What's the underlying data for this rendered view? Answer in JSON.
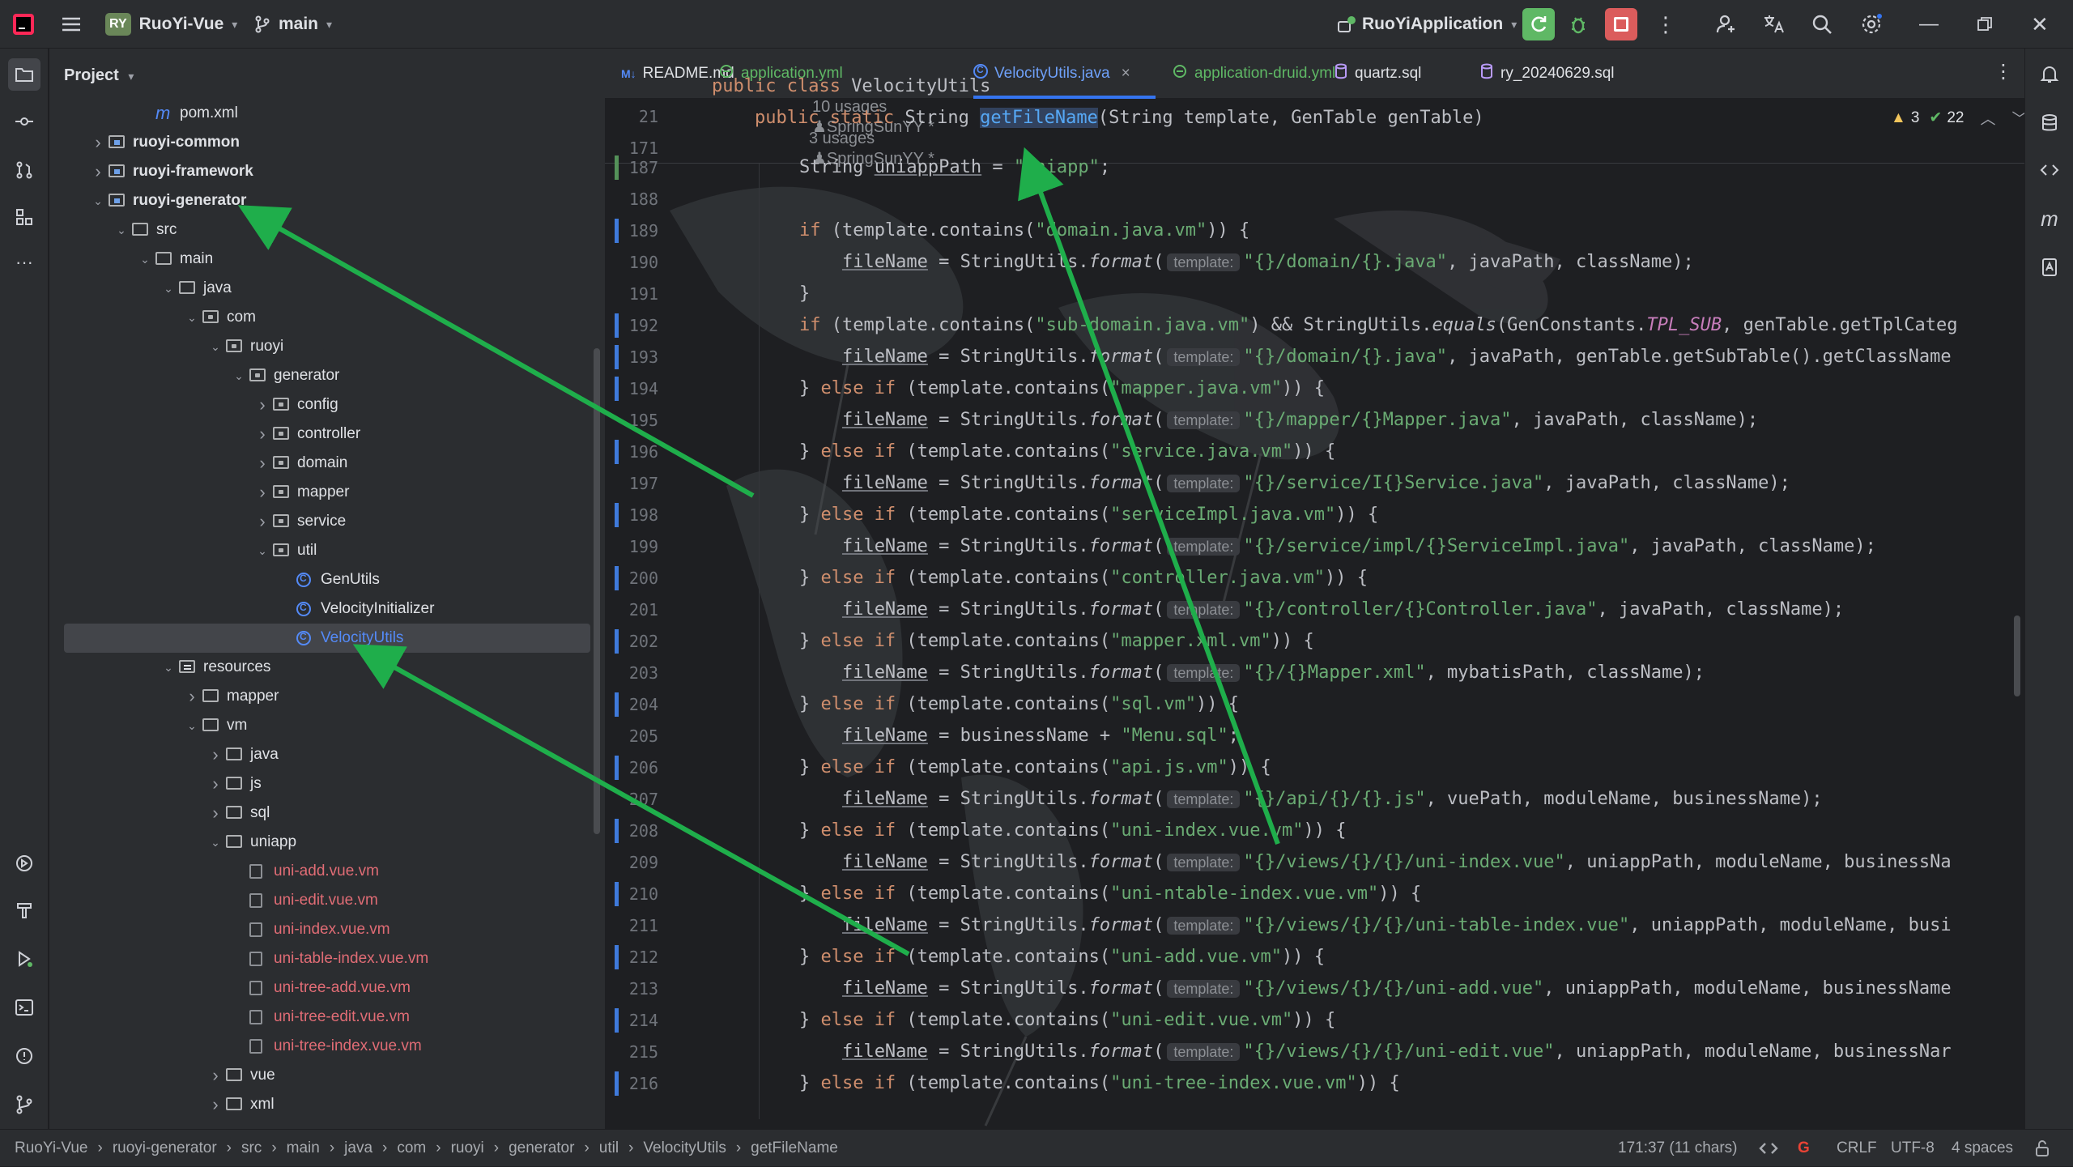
{
  "titlebar": {
    "app_badge": "RY",
    "project": "RuoYi-Vue",
    "branch": "main",
    "run_config": "RuoYiApplication"
  },
  "project_panel": {
    "title": "Project",
    "rows": [
      {
        "label": "pom.xml",
        "kind": "mfile",
        "depth": 3,
        "style": ""
      },
      {
        "label": "ruoyi-common",
        "kind": "mod",
        "depth": 1,
        "style": "bold",
        "arrow": "right"
      },
      {
        "label": "ruoyi-framework",
        "kind": "mod",
        "depth": 1,
        "style": "bold",
        "arrow": "right"
      },
      {
        "label": "ruoyi-generator",
        "kind": "mod",
        "depth": 1,
        "style": "bold",
        "arrow": "down"
      },
      {
        "label": "src",
        "kind": "folder",
        "depth": 2,
        "style": "",
        "arrow": "down"
      },
      {
        "label": "main",
        "kind": "folder",
        "depth": 3,
        "style": "",
        "arrow": "down"
      },
      {
        "label": "java",
        "kind": "folder",
        "depth": 4,
        "style": "",
        "arrow": "down"
      },
      {
        "label": "com",
        "kind": "pkg",
        "depth": 5,
        "style": "",
        "arrow": "down"
      },
      {
        "label": "ruoyi",
        "kind": "pkg",
        "depth": 6,
        "style": "",
        "arrow": "down"
      },
      {
        "label": "generator",
        "kind": "pkg",
        "depth": 7,
        "style": "",
        "arrow": "down"
      },
      {
        "label": "config",
        "kind": "pkg",
        "depth": 8,
        "style": "",
        "arrow": "right"
      },
      {
        "label": "controller",
        "kind": "pkg",
        "depth": 8,
        "style": "",
        "arrow": "right"
      },
      {
        "label": "domain",
        "kind": "pkg",
        "depth": 8,
        "style": "",
        "arrow": "right"
      },
      {
        "label": "mapper",
        "kind": "pkg",
        "depth": 8,
        "style": "",
        "arrow": "right"
      },
      {
        "label": "service",
        "kind": "pkg",
        "depth": 8,
        "style": "",
        "arrow": "right"
      },
      {
        "label": "util",
        "kind": "pkg",
        "depth": 8,
        "style": "",
        "arrow": "down"
      },
      {
        "label": "GenUtils",
        "kind": "class",
        "depth": 9,
        "style": ""
      },
      {
        "label": "VelocityInitializer",
        "kind": "class",
        "depth": 9,
        "style": ""
      },
      {
        "label": "VelocityUtils",
        "kind": "class",
        "depth": 9,
        "style": "blue",
        "selected": true
      },
      {
        "label": "resources",
        "kind": "res",
        "depth": 4,
        "style": "",
        "arrow": "down"
      },
      {
        "label": "mapper",
        "kind": "folder",
        "depth": 5,
        "style": "",
        "arrow": "right"
      },
      {
        "label": "vm",
        "kind": "folder",
        "depth": 5,
        "style": "",
        "arrow": "down"
      },
      {
        "label": "java",
        "kind": "folder",
        "depth": 6,
        "style": "",
        "arrow": "right"
      },
      {
        "label": "js",
        "kind": "folder",
        "depth": 6,
        "style": "",
        "arrow": "right"
      },
      {
        "label": "sql",
        "kind": "folder",
        "depth": 6,
        "style": "",
        "arrow": "right"
      },
      {
        "label": "uniapp",
        "kind": "folder",
        "depth": 6,
        "style": "",
        "arrow": "down"
      },
      {
        "label": "uni-add.vue.vm",
        "kind": "vm",
        "depth": 7,
        "style": "red"
      },
      {
        "label": "uni-edit.vue.vm",
        "kind": "vm",
        "depth": 7,
        "style": "red"
      },
      {
        "label": "uni-index.vue.vm",
        "kind": "vm",
        "depth": 7,
        "style": "red"
      },
      {
        "label": "uni-table-index.vue.vm",
        "kind": "vm",
        "depth": 7,
        "style": "red"
      },
      {
        "label": "uni-tree-add.vue.vm",
        "kind": "vm",
        "depth": 7,
        "style": "red"
      },
      {
        "label": "uni-tree-edit.vue.vm",
        "kind": "vm",
        "depth": 7,
        "style": "red"
      },
      {
        "label": "uni-tree-index.vue.vm",
        "kind": "vm",
        "depth": 7,
        "style": "red"
      },
      {
        "label": "vue",
        "kind": "folder",
        "depth": 6,
        "style": "",
        "arrow": "right"
      },
      {
        "label": "xml",
        "kind": "folder",
        "depth": 6,
        "style": "",
        "arrow": "right"
      }
    ]
  },
  "tabs": [
    {
      "label": "README.md",
      "prefix": "M↓",
      "active": false
    },
    {
      "label": "application.yml",
      "prefix": "",
      "active": false
    },
    {
      "label": "VelocityUtils.java",
      "prefix": "",
      "active": true,
      "close": "×"
    },
    {
      "label": "application-druid.yml",
      "prefix": "",
      "active": false
    },
    {
      "label": "quartz.sql",
      "prefix": "",
      "active": false
    },
    {
      "label": "ry_20240629.sql",
      "prefix": "",
      "active": false
    }
  ],
  "sticky": {
    "line1_num": "21",
    "line1_code": "public class VelocityUtils",
    "line1_usages": "10 usages",
    "line1_author": "SpringSunYY *",
    "line2_num": "171",
    "line2_usages": "3 usages",
    "line2_author": "SpringSunYY *",
    "warnings": "3",
    "checks": "22"
  },
  "code_lines": [
    {
      "n": "187",
      "html": "        String <span class=\"fld\">uniappPath</span> = <span class=\"str\">\"uniapp\"</span>;"
    },
    {
      "n": "188",
      "html": ""
    },
    {
      "n": "189",
      "html": "        <span class=\"kw\">if</span> (template.contains(<span class=\"str\">\"domain.java.vm\"</span>)) {"
    },
    {
      "n": "190",
      "html": "            <span class=\"fld\">fileName</span> = StringUtils.<span class=\"it\">format</span>(<span class=\"hint\">template:</span><span class=\"str\">\"{}/domain/{}.java\"</span>, javaPath, className);"
    },
    {
      "n": "191",
      "html": "        }"
    },
    {
      "n": "192",
      "html": "        <span class=\"kw\">if</span> (template.contains(<span class=\"str\">\"sub-domain.java.vm\"</span>) &amp;&amp; StringUtils.<span class=\"it\">equals</span>(GenConstants.<span class=\"cst\">TPL_SUB</span>, genTable.getTplCateg"
    },
    {
      "n": "193",
      "html": "            <span class=\"fld\">fileName</span> = StringUtils.<span class=\"it\">format</span>(<span class=\"hint\">template:</span><span class=\"str\">\"{}/domain/{}.java\"</span>, javaPath, genTable.getSubTable().getClassName"
    },
    {
      "n": "194",
      "html": "        } <span class=\"kw\">else if</span> (template.contains(<span class=\"str\">\"mapper.java.vm\"</span>)) {"
    },
    {
      "n": "195",
      "html": "            <span class=\"fld\">fileName</span> = StringUtils.<span class=\"it\">format</span>(<span class=\"hint\">template:</span><span class=\"str\">\"{}/mapper/{}Mapper.java\"</span>, javaPath, className);"
    },
    {
      "n": "196",
      "html": "        } <span class=\"kw\">else if</span> (template.contains(<span class=\"str\">\"service.java.vm\"</span>)) {"
    },
    {
      "n": "197",
      "html": "            <span class=\"fld\">fileName</span> = StringUtils.<span class=\"it\">format</span>(<span class=\"hint\">template:</span><span class=\"str\">\"{}/service/I{}Service.java\"</span>, javaPath, className);"
    },
    {
      "n": "198",
      "html": "        } <span class=\"kw\">else if</span> (template.contains(<span class=\"str\">\"serviceImpl.java.vm\"</span>)) {"
    },
    {
      "n": "199",
      "html": "            <span class=\"fld\">fileName</span> = StringUtils.<span class=\"it\">format</span>(<span class=\"hint\">template:</span><span class=\"str\">\"{}/service/impl/{}ServiceImpl.java\"</span>, javaPath, className);"
    },
    {
      "n": "200",
      "html": "        } <span class=\"kw\">else if</span> (template.contains(<span class=\"str\">\"controller.java.vm\"</span>)) {"
    },
    {
      "n": "201",
      "html": "            <span class=\"fld\">fileName</span> = StringUtils.<span class=\"it\">format</span>(<span class=\"hint\">template:</span><span class=\"str\">\"{}/controller/{}Controller.java\"</span>, javaPath, className);"
    },
    {
      "n": "202",
      "html": "        } <span class=\"kw\">else if</span> (template.contains(<span class=\"str\">\"mapper.xml.vm\"</span>)) {"
    },
    {
      "n": "203",
      "html": "            <span class=\"fld\">fileName</span> = StringUtils.<span class=\"it\">format</span>(<span class=\"hint\">template:</span><span class=\"str\">\"{}/{}Mapper.xml\"</span>, mybatisPath, className);"
    },
    {
      "n": "204",
      "html": "        } <span class=\"kw\">else if</span> (template.contains(<span class=\"str\">\"sql.vm\"</span>)) {"
    },
    {
      "n": "205",
      "html": "            <span class=\"fld\">fileName</span> = businessName + <span class=\"str\">\"Menu.sql\"</span>;"
    },
    {
      "n": "206",
      "html": "        } <span class=\"kw\">else if</span> (template.contains(<span class=\"str\">\"api.js.vm\"</span>)) {"
    },
    {
      "n": "207",
      "html": "            <span class=\"fld\">fileName</span> = StringUtils.<span class=\"it\">format</span>(<span class=\"hint\">template:</span><span class=\"str\">\"{}/api/{}/{}.js\"</span>, vuePath, moduleName, businessName);"
    },
    {
      "n": "208",
      "html": "        } <span class=\"kw\">else if</span> (template.contains(<span class=\"str\">\"uni-index.vue.vm\"</span>)) {"
    },
    {
      "n": "209",
      "html": "            <span class=\"fld\">fileName</span> = StringUtils.<span class=\"it\">format</span>(<span class=\"hint\">template:</span><span class=\"str\">\"{}/views/{}/{}/uni-index.vue\"</span>, uniappPath, moduleName, businessNa"
    },
    {
      "n": "210",
      "html": "        } <span class=\"kw\">else if</span> (template.contains(<span class=\"str\">\"uni-ntable-index.vue.vm\"</span>)) {"
    },
    {
      "n": "211",
      "html": "            <span class=\"fld\">fileName</span> = StringUtils.<span class=\"it\">format</span>(<span class=\"hint\">template:</span><span class=\"str\">\"{}/views/{}/{}/uni-table-index.vue\"</span>, uniappPath, moduleName, busi"
    },
    {
      "n": "212",
      "html": "        } <span class=\"kw\">else if</span> (template.contains(<span class=\"str\">\"uni-add.vue.vm\"</span>)) {"
    },
    {
      "n": "213",
      "html": "            <span class=\"fld\">fileName</span> = StringUtils.<span class=\"it\">format</span>(<span class=\"hint\">template:</span><span class=\"str\">\"{}/views/{}/{}/uni-add.vue\"</span>, uniappPath, moduleName, businessName"
    },
    {
      "n": "214",
      "html": "        } <span class=\"kw\">else if</span> (template.contains(<span class=\"str\">\"uni-edit.vue.vm\"</span>)) {"
    },
    {
      "n": "215",
      "html": "            <span class=\"fld\">fileName</span> = StringUtils.<span class=\"it\">format</span>(<span class=\"hint\">template:</span><span class=\"str\">\"{}/views/{}/{}/uni-edit.vue\"</span>, uniappPath, moduleName, businessNar"
    },
    {
      "n": "216",
      "html": "        } <span class=\"kw\">else if</span> (template.contains(<span class=\"str\">\"uni-tree-index.vue.vm\"</span>)) {"
    }
  ],
  "gutter_marks": [
    "187",
    "189",
    "192",
    "193",
    "194",
    "196",
    "198",
    "200",
    "202",
    "204",
    "206",
    "208",
    "210",
    "212",
    "214",
    "216"
  ],
  "statusbar": {
    "crumbs": [
      "RuoYi-Vue",
      "ruoyi-generator",
      "src",
      "main",
      "java",
      "com",
      "ruoyi",
      "generator",
      "util",
      "VelocityUtils",
      "getFileName"
    ],
    "position": "171:37 (11 chars)",
    "line_sep": "CRLF",
    "encoding": "UTF-8",
    "indent": "4 spaces"
  },
  "colors": {
    "annotation_arrow": "#1fae4b",
    "accent": "#3574f0"
  }
}
